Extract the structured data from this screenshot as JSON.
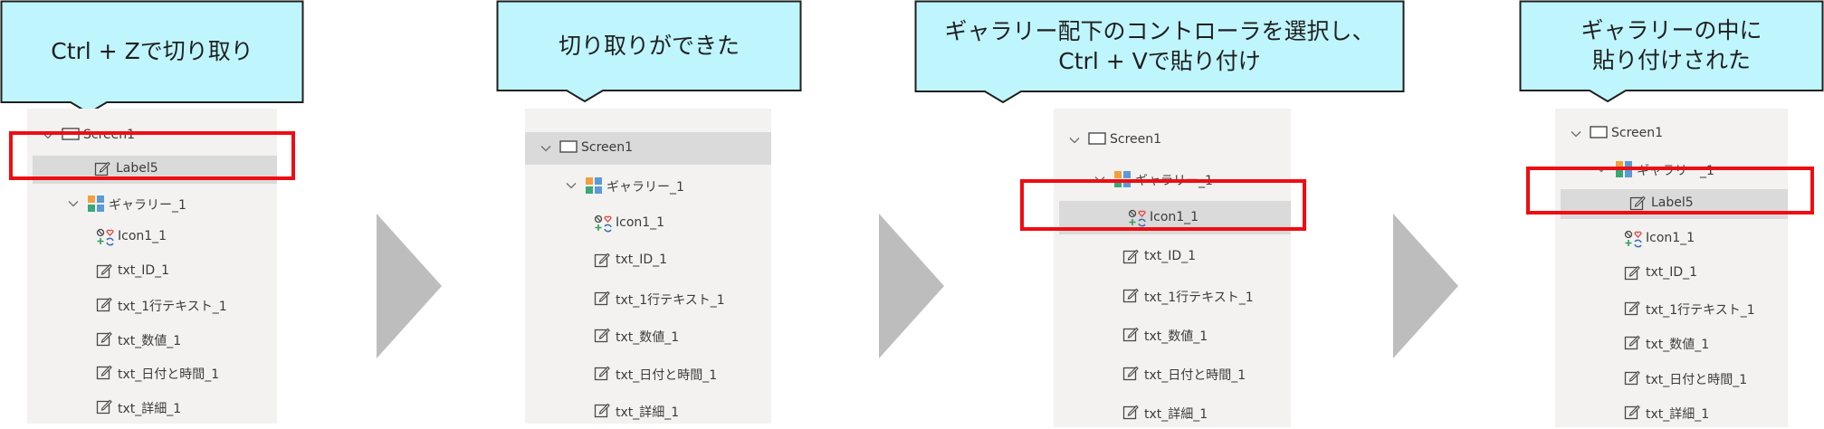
{
  "steps": [
    {
      "caption": [
        "Ctrl + Zで切り取り"
      ],
      "items": [
        {
          "label": "Screen1",
          "kind": "screen",
          "indent": 0,
          "chevron": true,
          "selected": false
        },
        {
          "label": "Label5",
          "kind": "edit",
          "indent": 1,
          "chevron": false,
          "selected": true
        },
        {
          "label": "ギャラリー_1",
          "kind": "gallery",
          "indent": 1,
          "chevron": true,
          "selected": false
        },
        {
          "label": "Icon1_1",
          "kind": "icons",
          "indent": 2,
          "chevron": false,
          "selected": false
        },
        {
          "label": "txt_ID_1",
          "kind": "edit",
          "indent": 2,
          "chevron": false,
          "selected": false
        },
        {
          "label": "txt_1行テキスト_1",
          "kind": "edit",
          "indent": 2,
          "chevron": false,
          "selected": false
        },
        {
          "label": "txt_数値_1",
          "kind": "edit",
          "indent": 2,
          "chevron": false,
          "selected": false
        },
        {
          "label": "txt_日付と時間_1",
          "kind": "edit",
          "indent": 2,
          "chevron": false,
          "selected": false
        },
        {
          "label": "txt_詳細_1",
          "kind": "edit",
          "indent": 2,
          "chevron": false,
          "selected": false
        }
      ]
    },
    {
      "caption": [
        "切り取りができた"
      ],
      "items": [
        {
          "label": "Screen1",
          "kind": "screen",
          "indent": 0,
          "chevron": true,
          "selected": true
        },
        {
          "label": "ギャラリー_1",
          "kind": "gallery",
          "indent": 1,
          "chevron": true,
          "selected": false
        },
        {
          "label": "Icon1_1",
          "kind": "icons",
          "indent": 2,
          "chevron": false,
          "selected": false
        },
        {
          "label": "txt_ID_1",
          "kind": "edit",
          "indent": 2,
          "chevron": false,
          "selected": false
        },
        {
          "label": "txt_1行テキスト_1",
          "kind": "edit",
          "indent": 2,
          "chevron": false,
          "selected": false
        },
        {
          "label": "txt_数値_1",
          "kind": "edit",
          "indent": 2,
          "chevron": false,
          "selected": false
        },
        {
          "label": "txt_日付と時間_1",
          "kind": "edit",
          "indent": 2,
          "chevron": false,
          "selected": false
        },
        {
          "label": "txt_詳細_1",
          "kind": "edit",
          "indent": 2,
          "chevron": false,
          "selected": false
        }
      ]
    },
    {
      "caption": [
        "ギャラリー配下のコントローラを選択し、",
        "Ctrl + Vで貼り付け"
      ],
      "items": [
        {
          "label": "Screen1",
          "kind": "screen",
          "indent": 0,
          "chevron": true,
          "selected": false
        },
        {
          "label": "ギャラリー_1",
          "kind": "gallery",
          "indent": 1,
          "chevron": true,
          "selected": false
        },
        {
          "label": "Icon1_1",
          "kind": "icons",
          "indent": 2,
          "chevron": false,
          "selected": true
        },
        {
          "label": "txt_ID_1",
          "kind": "edit",
          "indent": 2,
          "chevron": false,
          "selected": false
        },
        {
          "label": "txt_1行テキスト_1",
          "kind": "edit",
          "indent": 2,
          "chevron": false,
          "selected": false
        },
        {
          "label": "txt_数値_1",
          "kind": "edit",
          "indent": 2,
          "chevron": false,
          "selected": false
        },
        {
          "label": "txt_日付と時間_1",
          "kind": "edit",
          "indent": 2,
          "chevron": false,
          "selected": false
        },
        {
          "label": "txt_詳細_1",
          "kind": "edit",
          "indent": 2,
          "chevron": false,
          "selected": false
        }
      ]
    },
    {
      "caption": [
        "ギャラリーの中に",
        "貼り付けされた"
      ],
      "items": [
        {
          "label": "Screen1",
          "kind": "screen",
          "indent": 0,
          "chevron": true,
          "selected": false
        },
        {
          "label": "ギャラリー_1",
          "kind": "gallery",
          "indent": 1,
          "chevron": true,
          "selected": false
        },
        {
          "label": "Label5",
          "kind": "edit",
          "indent": 2,
          "chevron": false,
          "selected": true
        },
        {
          "label": "Icon1_1",
          "kind": "icons",
          "indent": 2,
          "chevron": false,
          "selected": false
        },
        {
          "label": "txt_ID_1",
          "kind": "edit",
          "indent": 2,
          "chevron": false,
          "selected": false
        },
        {
          "label": "txt_1行テキスト_1",
          "kind": "edit",
          "indent": 2,
          "chevron": false,
          "selected": false
        },
        {
          "label": "txt_数値_1",
          "kind": "edit",
          "indent": 2,
          "chevron": false,
          "selected": false
        },
        {
          "label": "txt_日付と時間_1",
          "kind": "edit",
          "indent": 2,
          "chevron": false,
          "selected": false
        },
        {
          "label": "txt_詳細_1",
          "kind": "edit",
          "indent": 2,
          "chevron": false,
          "selected": false
        }
      ]
    }
  ],
  "colors": {
    "callout_fill": "#bff5fd",
    "callout_border": "#1f1f1f",
    "tree_bg": "#f3f2f1",
    "selected_row": "#dadada",
    "highlight_box": "#ee0d12",
    "arrow": "#bdbdbd"
  }
}
